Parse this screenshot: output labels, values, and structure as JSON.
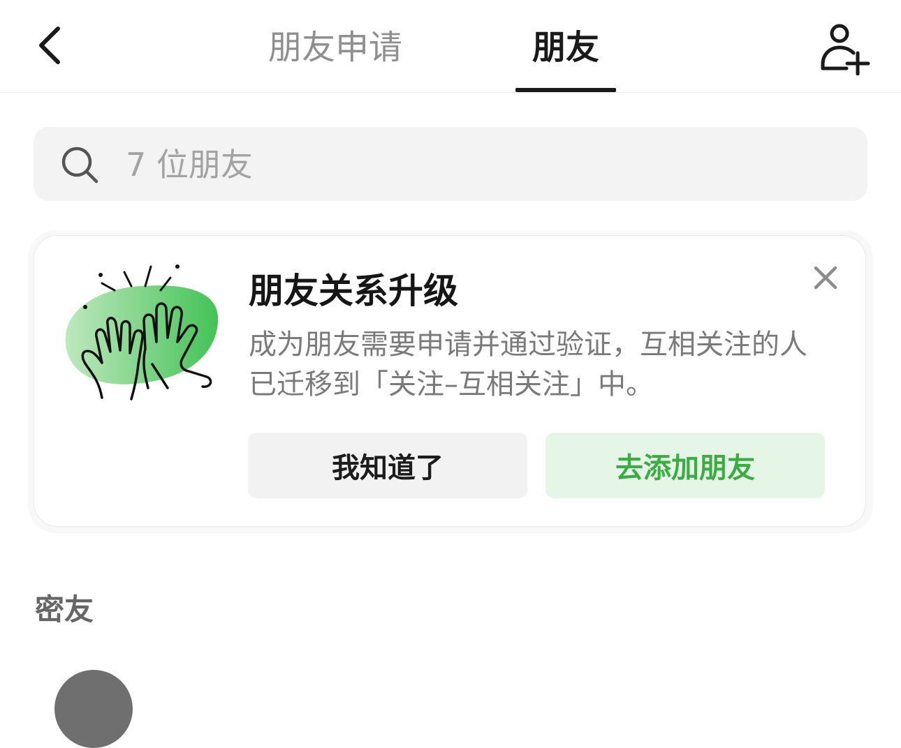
{
  "header": {
    "tabs": [
      {
        "label": "朋友申请",
        "active": false
      },
      {
        "label": "朋友",
        "active": true
      }
    ],
    "back_icon": "chevron-left-icon",
    "add_icon": "user-plus-icon"
  },
  "search": {
    "placeholder": "7 位朋友",
    "icon": "search-icon"
  },
  "upgrade_card": {
    "title": "朋友关系升级",
    "body": "成为朋友需要申请并通过验证，互相关注的人已迁移到「关注–互相关注」中。",
    "close_icon": "close-icon",
    "illustration": "high-five-hands-illustration",
    "buttons": {
      "acknowledge": "我知道了",
      "add_friends": "去添加朋友"
    }
  },
  "sections": {
    "close_friends_label": "密友"
  },
  "colors": {
    "accent_green": "#3bab43",
    "accent_green_bg": "#e6f6e6",
    "text_primary": "#1a1a1a",
    "text_secondary": "#7a7a7a",
    "search_bg": "#f3f3f4"
  }
}
